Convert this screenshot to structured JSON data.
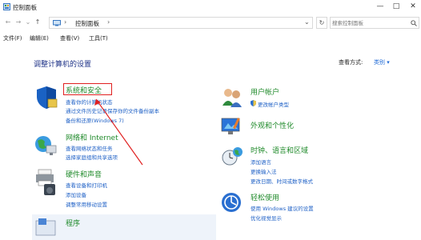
{
  "window": {
    "title": "控制面板",
    "minimize_glyph": "—",
    "maximize_glyph": "□",
    "close_glyph": "✕"
  },
  "address_bar": {
    "back_glyph": "←",
    "forward_glyph": "→",
    "recent_glyph": "⌄",
    "up_glyph": "↑",
    "separator": "›",
    "crumb": "控制面板",
    "dropdown_glyph": "⌄",
    "refresh_glyph": "↻",
    "search_placeholder": "搜索控制面板",
    "search_icon": "search-icon"
  },
  "menu": [
    "文件(F)",
    "编辑(E)",
    "查看(V)",
    "工具(T)"
  ],
  "main": {
    "heading": "调整计算机的设置",
    "view_by_label": "查看方式:",
    "view_by_value": "类别 ▾",
    "categories": [
      {
        "name": "system-security",
        "title": "系统和安全",
        "icon": "shield-icon",
        "links": [
          "查看你的计算机状态",
          "通过文件历史记录保存你的文件备份副本",
          "备份和还原(Windows 7)"
        ]
      },
      {
        "name": "network-internet",
        "title": "网络和 Internet",
        "icon": "globe-network-icon",
        "links": [
          "查看网络状态和任务",
          "选择家庭组和共享选项"
        ]
      },
      {
        "name": "hardware-sound",
        "title": "硬件和声音",
        "icon": "printer-speaker-icon",
        "links": [
          "查看设备和打印机",
          "添加设备",
          "调整常用移动设置"
        ]
      },
      {
        "name": "programs",
        "title": "程序",
        "icon": "programs-icon",
        "links": []
      },
      {
        "name": "user-accounts",
        "title": "用户帐户",
        "icon": "users-icon",
        "links": [
          "更改帐户类型"
        ]
      },
      {
        "name": "appearance",
        "title": "外观和个性化",
        "icon": "monitor-brush-icon",
        "links": []
      },
      {
        "name": "clock-language-region",
        "title": "时钟、语言和区域",
        "icon": "clock-globe-icon",
        "links": [
          "添加语言",
          "更换输入法",
          "更改日期、时间或数字格式"
        ]
      },
      {
        "name": "ease-of-access",
        "title": "轻松使用",
        "icon": "ease-of-access-icon",
        "links": [
          "使用 Windows 建议的设置",
          "优化视觉显示"
        ]
      }
    ]
  },
  "colors": {
    "heading": "#1e3287",
    "category_title": "#1f8a2a",
    "link": "#1e60c6",
    "highlight": "#e02020"
  }
}
